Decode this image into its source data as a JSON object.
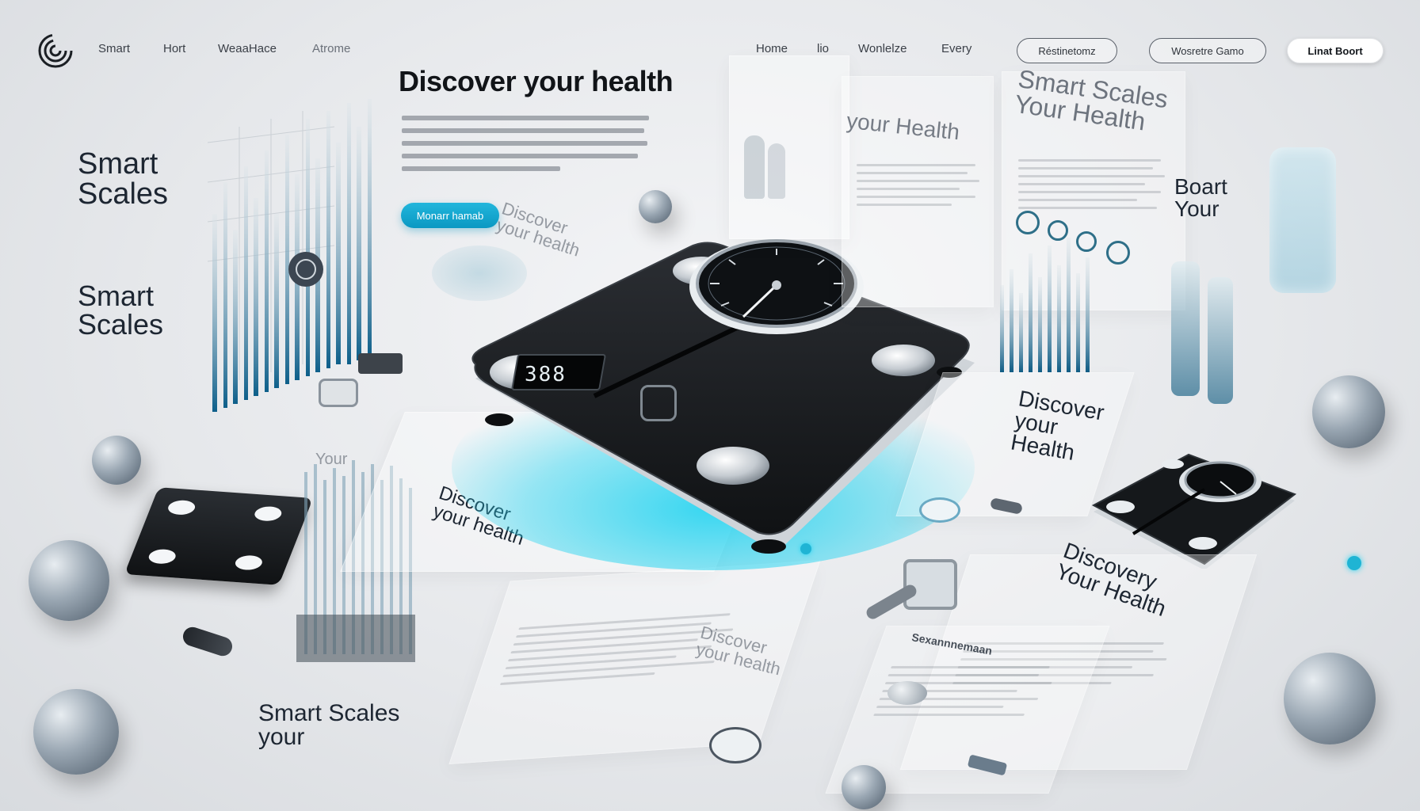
{
  "nav": {
    "left_links": [
      "Smart",
      "Hort",
      "WeaaHace",
      "Atrome"
    ],
    "right_links": [
      "Home",
      "lio",
      "Wonlelze",
      "Every"
    ],
    "buttons": [
      "Réstinetomz",
      "Wosretre Gamo",
      "Linat Boort"
    ]
  },
  "hero": {
    "title": "Discover your health",
    "cta": "Monarr hamab"
  },
  "scale": {
    "display": "388"
  },
  "floating": {
    "smart_scales_1": "Smart\nScales",
    "smart_scales_2": "Smart\nScales",
    "discover_1": "Discover\nyour health",
    "your_health_1": "your Health",
    "smart_scales_your_health": "Smart Scales\nYour Health",
    "boart_your": "Boart\nYour",
    "discover_your_health_2": "Discover\nyour\nHealth",
    "discover_your_health_3": "Discover\nyour health",
    "discover_your_health_4": "Discover\nyour health",
    "discover_your_health_5": "Discovery\nYour Health",
    "smart_scales_your": "Smart Scales\nyour",
    "your_small": "Your",
    "heading_small": "Sexannnemaan"
  },
  "colors": {
    "accent": "#16a9d4",
    "glow": "#22d3f0",
    "scale_body": "#141618"
  }
}
